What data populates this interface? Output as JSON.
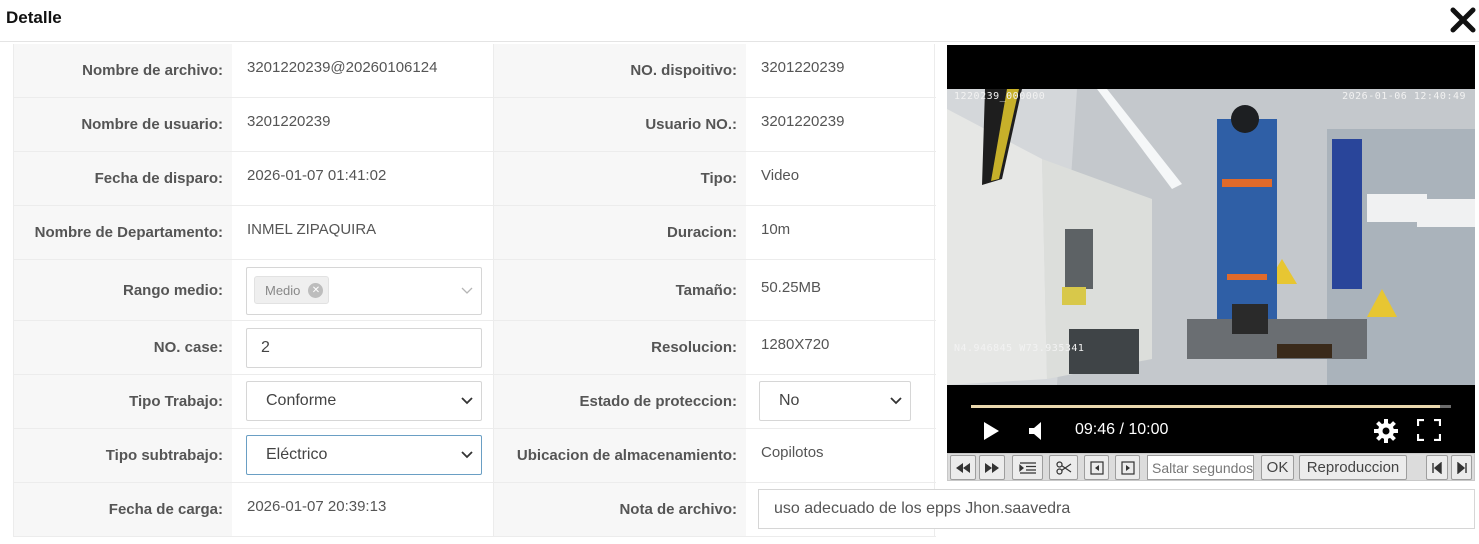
{
  "header": {
    "title": "Detalle"
  },
  "fields": {
    "file_name": {
      "label": "Nombre de archivo:",
      "value": "3201220239@20260106124"
    },
    "device_no": {
      "label": "NO. dispoitivo:",
      "value": "3201220239"
    },
    "user_name": {
      "label": "Nombre de usuario:",
      "value": "3201220239"
    },
    "user_no": {
      "label": "Usuario NO.:",
      "value": "3201220239"
    },
    "trigger_date": {
      "label": "Fecha de disparo:",
      "value": "2026-01-07 01:41:02"
    },
    "type": {
      "label": "Tipo:",
      "value": "Video"
    },
    "department": {
      "label": "Nombre de Departamento:",
      "value": "INMEL ZIPAQUIRA"
    },
    "duration": {
      "label": "Duracion:",
      "value": "10m"
    },
    "media_range": {
      "label": "Rango medio:",
      "tag": "Medio"
    },
    "size": {
      "label": "Tamaño:",
      "value": "50.25MB"
    },
    "case_no": {
      "label": "NO. case:",
      "value": "2"
    },
    "resolution": {
      "label": "Resolucion:",
      "value": "1280X720"
    },
    "work_type": {
      "label": "Tipo Trabajo:",
      "value": "Conforme"
    },
    "protection_state": {
      "label": "Estado de proteccion:",
      "value": "No"
    },
    "subwork_type": {
      "label": "Tipo subtrabajo:",
      "value": "Eléctrico"
    },
    "storage_location": {
      "label": "Ubicacion de almacenamiento:",
      "value": "Copilotos"
    },
    "upload_date": {
      "label": "Fecha de carga:",
      "value": "2026-01-07 20:39:13"
    },
    "file_note": {
      "label": "Nota de archivo:",
      "value": "uso adecuado de los epps Jhon.saavedra"
    }
  },
  "video": {
    "overlay_top_left": "1220239_000000",
    "overlay_top_right": "2026-01-06 12:40:49",
    "overlay_bottom_left": "N4.946845 W73.935341",
    "time_display": "09:46 / 10:00",
    "progress": 0.977
  },
  "toolbar": {
    "skip_placeholder": "Saltar segundos",
    "ok_label": "OK",
    "playback_label": "Reproduccion"
  },
  "colors": {
    "label_bg": "#f7f7f7",
    "border": "#ececec",
    "focus_border": "#6a9fc4",
    "progress_fill": "#ead8ae"
  }
}
